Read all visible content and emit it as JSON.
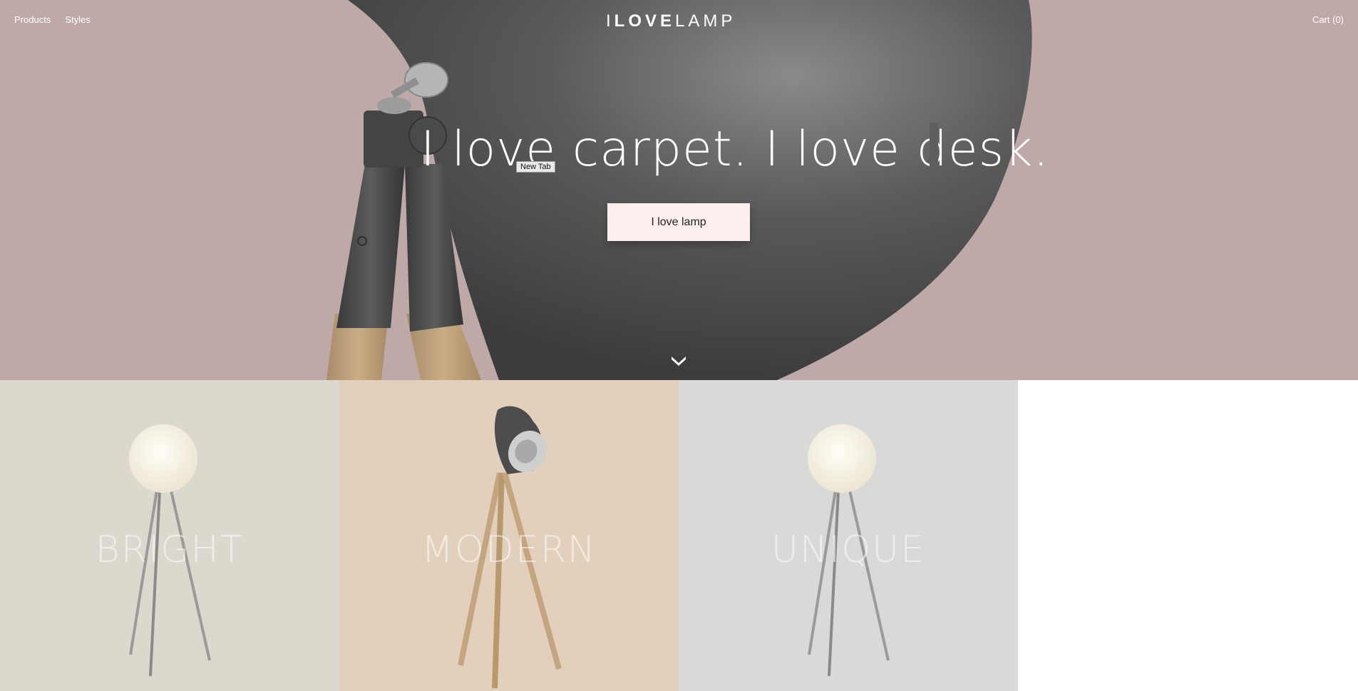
{
  "nav": {
    "products": "Products",
    "styles": "Styles",
    "cart": "Cart (0)"
  },
  "logo": {
    "part1": "I",
    "part2": "LOVE",
    "part3": "LAMP"
  },
  "hero": {
    "headline": "I love carpet. I love desk.",
    "tooltip": "New Tab",
    "cta": "I love lamp",
    "scroll_icon": "chevron-down-icon"
  },
  "tiles": [
    {
      "label": "BRIGHT",
      "lamp": "globe-tripod-lamp-image"
    },
    {
      "label": "MODERN",
      "lamp": "spotlight-tripod-lamp-image"
    },
    {
      "label": "UNIQUE",
      "lamp": "globe-tripod-lamp-image"
    }
  ],
  "colors": {
    "hero_bg": "#bfa8a8",
    "tile_bright": "#ddd8ce",
    "tile_modern": "#e2d0bd",
    "tile_unique": "#d9d9d8",
    "cta_bg": "#fdeeee"
  }
}
